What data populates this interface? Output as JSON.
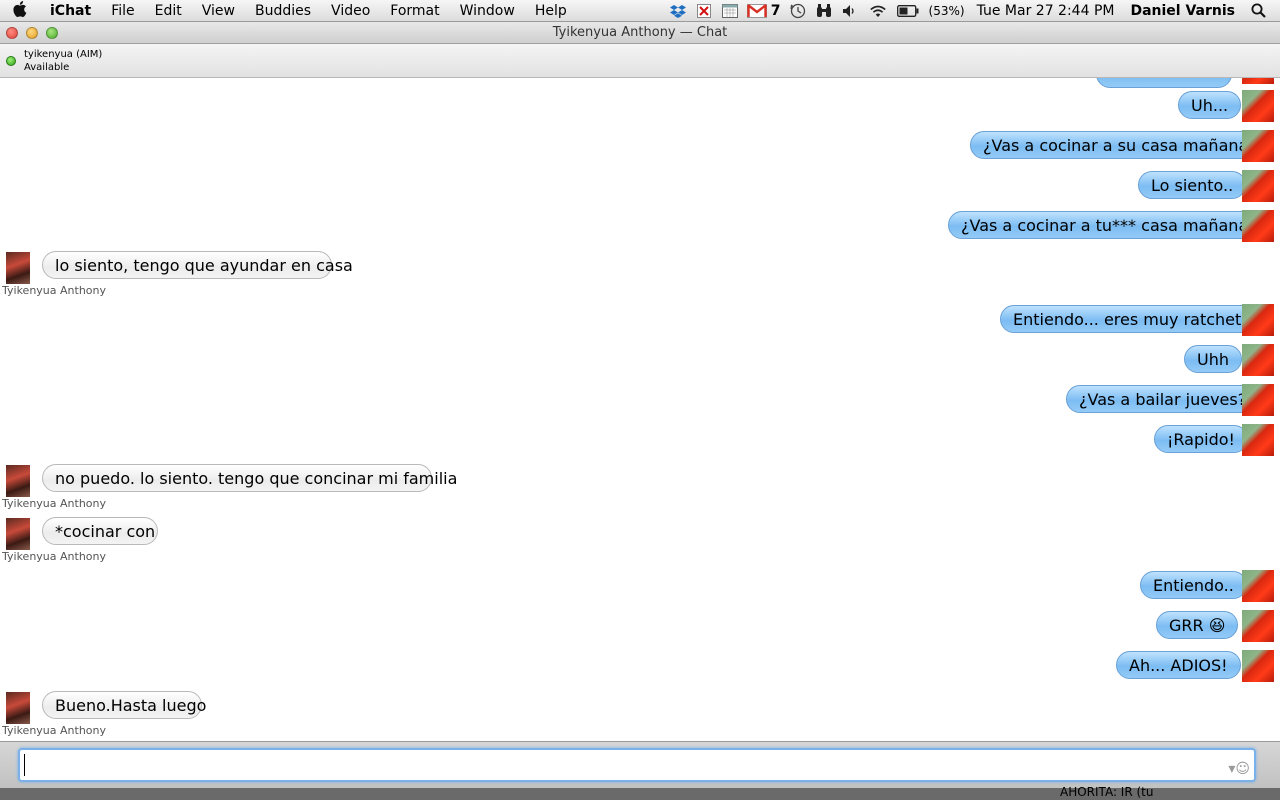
{
  "menubar": {
    "apple": "",
    "items": [
      "iChat",
      "File",
      "Edit",
      "View",
      "Buddies",
      "Video",
      "Format",
      "Window",
      "Help"
    ],
    "gmail_count": "7",
    "battery": "(53%)",
    "datetime": "Tue Mar 27  2:44 PM",
    "user": "Daniel Varnis"
  },
  "window": {
    "title": "Tyikenyua Anthony — Chat"
  },
  "buddy": {
    "screenname": "tyikenyua (AIM)",
    "status": "Available",
    "display_name": "Tyikenyua Anthony"
  },
  "messages": [
    {
      "from": "self",
      "text": "Uh..."
    },
    {
      "from": "self",
      "text": "¿Vas a cocinar a su casa mañana?"
    },
    {
      "from": "self",
      "text": "Lo siento.."
    },
    {
      "from": "self",
      "text": "¿Vas a cocinar a tu*** casa mañana?"
    },
    {
      "from": "buddy",
      "text": "lo siento, tengo que ayundar en casa"
    },
    {
      "from": "self",
      "text": "Entiendo... eres muy ratchet."
    },
    {
      "from": "self",
      "text": "Uhh"
    },
    {
      "from": "self",
      "text": "¿Vas a bailar jueves?"
    },
    {
      "from": "self",
      "text": "¡Rapido!"
    },
    {
      "from": "buddy",
      "text": "no puedo. lo siento. tengo que concinar mi familia"
    },
    {
      "from": "buddy",
      "text": "*cocinar con"
    },
    {
      "from": "self",
      "text": "Entiendo.."
    },
    {
      "from": "self",
      "text": "GRR 😆"
    },
    {
      "from": "self",
      "text": "Ah... ADIOS!"
    },
    {
      "from": "buddy",
      "text": "Bueno.Hasta luego"
    }
  ],
  "input": {
    "value": "",
    "emoticon": "☺"
  },
  "desktop_strip_text": "AHORITA:  IR (tu"
}
